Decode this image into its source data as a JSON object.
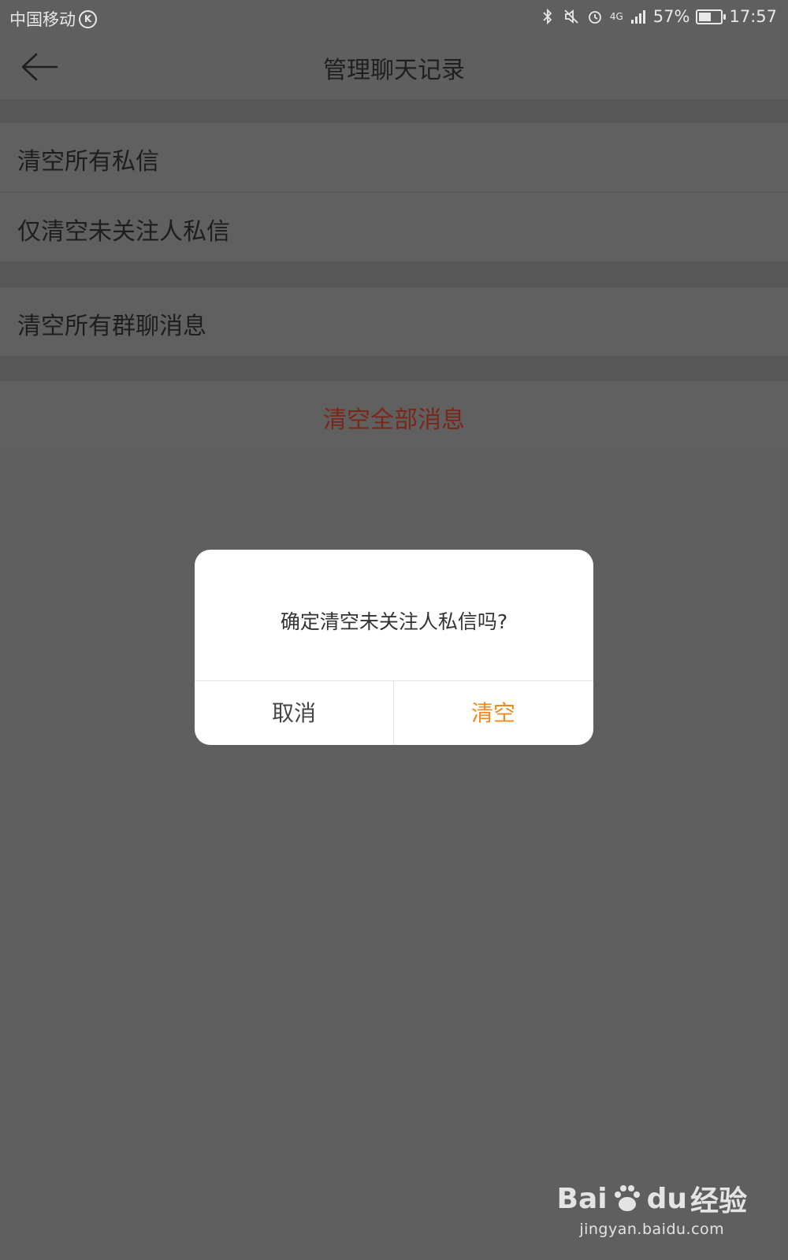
{
  "status_bar": {
    "carrier": "中国移动",
    "battery_percent": "57%",
    "battery_level": 0.57,
    "time": "17:57",
    "network": "4G"
  },
  "header": {
    "title": "管理聊天记录"
  },
  "settings": {
    "clear_all_private": "清空所有私信",
    "clear_unfollowed_private": "仅清空未关注人私信",
    "clear_all_group": "清空所有群聊消息",
    "clear_all_messages": "清空全部消息"
  },
  "dialog": {
    "message": "确定清空未关注人私信吗?",
    "cancel_label": "取消",
    "confirm_label": "清空"
  },
  "watermark": {
    "brand_prefix": "Bai",
    "brand_suffix": "du",
    "brand_cn": "经验",
    "url": "jingyan.baidu.com"
  },
  "colors": {
    "overlay": "#5f5f5f",
    "danger_text": "#7a2618",
    "confirm_text": "#f08a1c"
  }
}
